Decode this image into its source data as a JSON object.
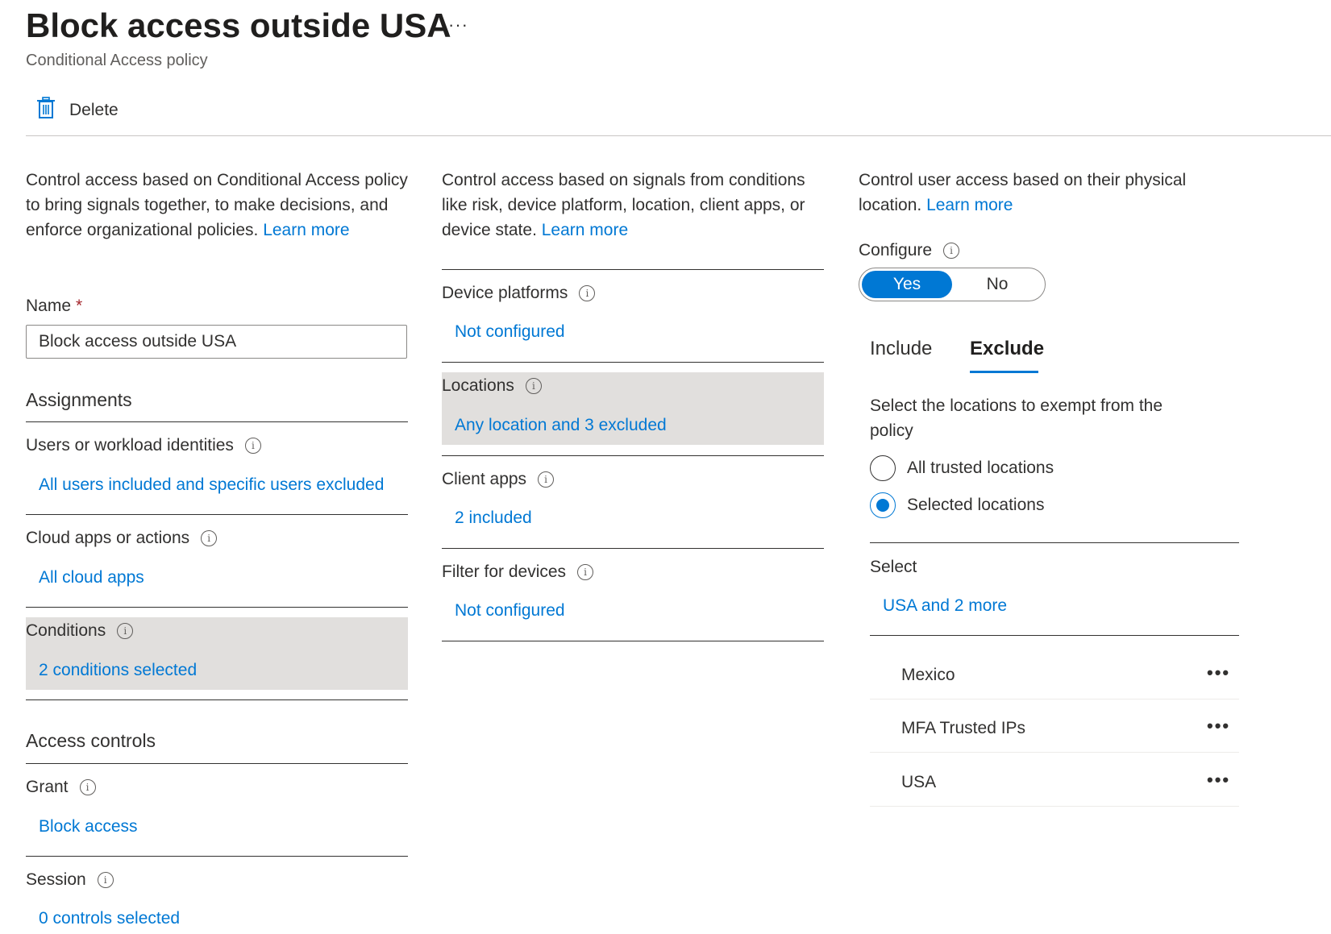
{
  "header": {
    "title": "Block access outside USA",
    "more_label": "···",
    "subtitle": "Conditional Access policy"
  },
  "toolbar": {
    "delete_label": "Delete",
    "delete_icon": "trash-icon"
  },
  "left": {
    "description": "Control access based on Conditional Access policy to bring signals together, to make decisions, and enforce organizational policies.",
    "learn_more": "Learn more",
    "name_label": "Name",
    "required_mark": "*",
    "name_value": "Block access outside USA",
    "assignments_title": "Assignments",
    "users_label": "Users or workload identities",
    "users_value": "All users included and specific users excluded",
    "apps_label": "Cloud apps or actions",
    "apps_value": "All cloud apps",
    "conditions_label": "Conditions",
    "conditions_value": "2 conditions selected",
    "access_controls_title": "Access controls",
    "grant_label": "Grant",
    "grant_value": "Block access",
    "session_label": "Session",
    "session_value": "0 controls selected"
  },
  "middle": {
    "description": "Control access based on signals from conditions like risk, device platform, location, client apps, or device state.",
    "learn_more": "Learn more",
    "device_platforms_label": "Device platforms",
    "device_platforms_value": "Not configured",
    "locations_label": "Locations",
    "locations_value": "Any location and 3 excluded",
    "client_apps_label": "Client apps",
    "client_apps_value": "2 included",
    "filter_devices_label": "Filter for devices",
    "filter_devices_value": "Not configured"
  },
  "right": {
    "description": "Control user access based on their physical location.",
    "learn_more": "Learn more",
    "configure_label": "Configure",
    "toggle_yes": "Yes",
    "toggle_no": "No",
    "tab_include": "Include",
    "tab_exclude": "Exclude",
    "exclude_description": "Select the locations to exempt from the policy",
    "radio_all_trusted": "All trusted locations",
    "radio_selected": "Selected locations",
    "select_label": "Select",
    "select_value": "USA and 2 more",
    "locations": [
      {
        "name": "Mexico",
        "more": "•••"
      },
      {
        "name": "MFA Trusted IPs",
        "more": "•••"
      },
      {
        "name": "USA",
        "more": "•••"
      }
    ]
  },
  "info_glyph": "i",
  "colors": {
    "accent": "#0078d4",
    "highlight": "#e1dfdd",
    "required": "#a4262c"
  }
}
